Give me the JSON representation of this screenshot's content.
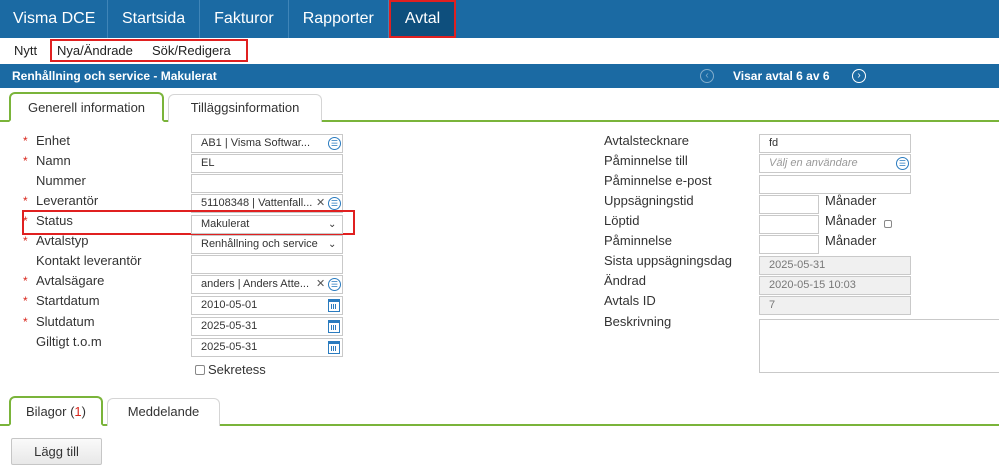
{
  "topnav": {
    "brand": "Visma DCE",
    "items": [
      "Startsida",
      "Fakturor",
      "Rapporter",
      "Avtal"
    ]
  },
  "subnav": {
    "items": [
      "Nytt",
      "Nya/Ändrade",
      "Sök/Redigera"
    ]
  },
  "titlebar": {
    "title": "Renhållning och service - Makulerat",
    "pager": "Visar avtal 6 av 6"
  },
  "tabs_top": [
    "Generell information",
    "Tilläggsinformation"
  ],
  "left_form": {
    "enhet": {
      "label": "Enhet",
      "value": "AB1 | Visma Softwar..."
    },
    "namn": {
      "label": "Namn",
      "value": "EL"
    },
    "nummer": {
      "label": "Nummer",
      "value": ""
    },
    "leverantor": {
      "label": "Leverantör",
      "value": "51108348 | Vattenfall..."
    },
    "status": {
      "label": "Status",
      "value": "Makulerat"
    },
    "avtalstyp": {
      "label": "Avtalstyp",
      "value": "Renhållning och service"
    },
    "kontakt": {
      "label": "Kontakt leverantör",
      "value": ""
    },
    "agare": {
      "label": "Avtalsägare",
      "value": "anders | Anders Atte..."
    },
    "startdatum": {
      "label": "Startdatum",
      "value": "2010-05-01"
    },
    "slutdatum": {
      "label": "Slutdatum",
      "value": "2025-05-31"
    },
    "giltigt": {
      "label": "Giltigt t.o.m",
      "value": "2025-05-31"
    },
    "sekretess": {
      "label": "Sekretess"
    }
  },
  "right_form": {
    "avtalstecknare": {
      "label": "Avtalstecknare",
      "value": "fd"
    },
    "paminnelse_till": {
      "label": "Påminnelse till",
      "placeholder": "Välj en användare"
    },
    "paminnelse_epost": {
      "label": "Påminnelse e-post",
      "value": ""
    },
    "uppsagningstid": {
      "label": "Uppsägningstid",
      "value": "",
      "unit": "Månader"
    },
    "loptid": {
      "label": "Löptid",
      "value": "",
      "unit": "Månader"
    },
    "paminnelse": {
      "label": "Påminnelse",
      "value": "",
      "unit": "Månader"
    },
    "sista": {
      "label": "Sista uppsägningsdag",
      "value": "2025-05-31"
    },
    "andrad": {
      "label": "Ändrad",
      "value": "2020-05-15 10:03"
    },
    "avtals_id": {
      "label": "Avtals ID",
      "value": "7"
    },
    "beskrivning": {
      "label": "Beskrivning"
    }
  },
  "tabs_bottom": {
    "bilagor": "Bilagor (",
    "bilagor_count": "1",
    "bilagor_close": ")",
    "meddelande": "Meddelande"
  },
  "add_button": "Lägg till",
  "colors": {
    "nav": "#1b6aa3",
    "accent": "#7ab43a",
    "highlight": "#e02020"
  }
}
